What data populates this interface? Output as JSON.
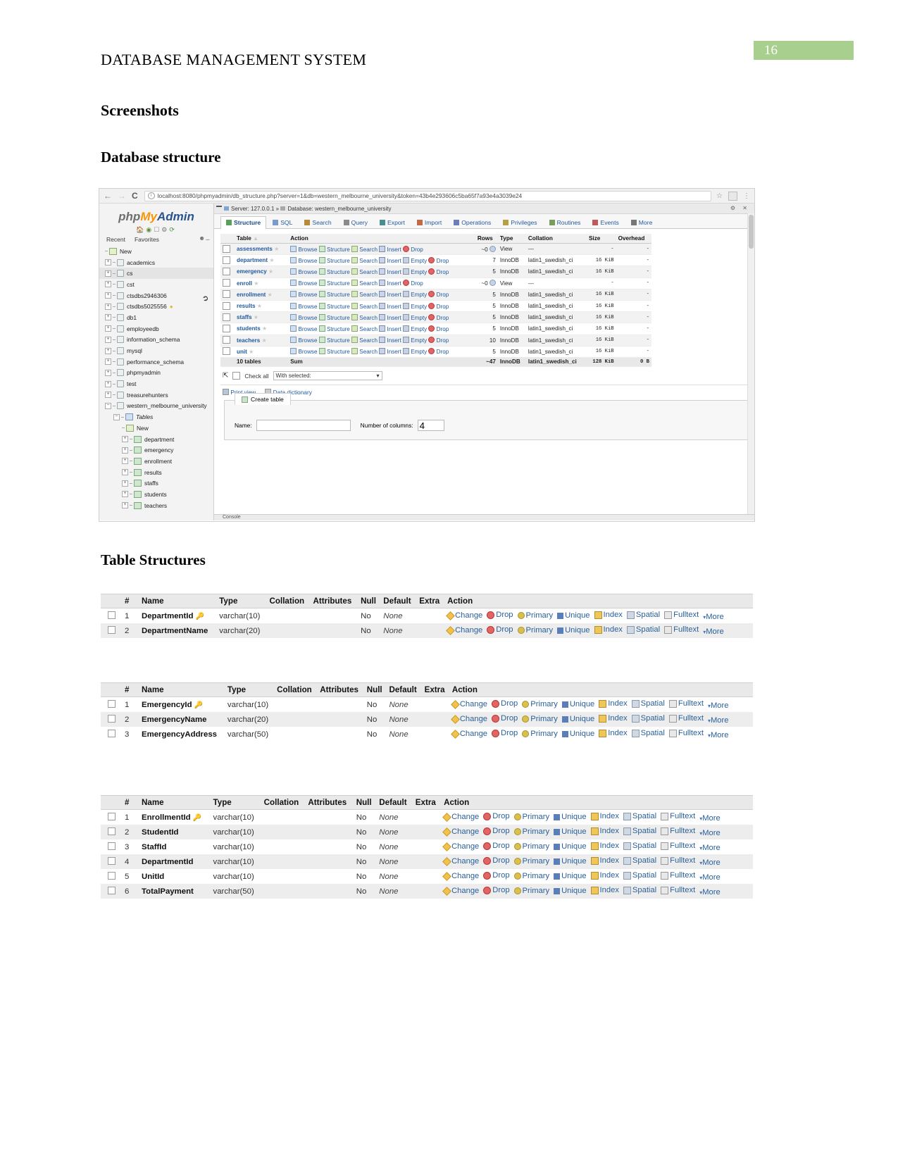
{
  "document": {
    "running_header": "DATABASE MANAGEMENT SYSTEM",
    "page_number": "16",
    "heading_screenshots": "Screenshots",
    "heading_db_structure": "Database structure",
    "heading_table_structures": "Table Structures"
  },
  "browser": {
    "back_icon": "←",
    "forward_icon": "→",
    "reload_icon": "C",
    "info_icon": "i",
    "url": "localhost:8080/phpmyadmin/db_structure.php?server=1&db=western_melbourne_university&token=43b4e293606c5ba65f7a93e4a3039e24",
    "star_icon": "☆",
    "menu_icon": "⋮"
  },
  "phpmyadmin": {
    "logo_php": "php",
    "logo_my": "My",
    "logo_admin": "Admin",
    "recent": "Recent",
    "favorites": "Favorites",
    "breadcrumb_server_label": "Server:",
    "breadcrumb_server_value": "127.0.0.1",
    "breadcrumb_sep": "»",
    "breadcrumb_db_label": "Database:",
    "breadcrumb_db_value": "western_melbourne_university",
    "tabs": [
      {
        "label": "Structure",
        "active": true
      },
      {
        "label": "SQL",
        "active": false
      },
      {
        "label": "Search",
        "active": false
      },
      {
        "label": "Query",
        "active": false
      },
      {
        "label": "Export",
        "active": false
      },
      {
        "label": "Import",
        "active": false
      },
      {
        "label": "Operations",
        "active": false
      },
      {
        "label": "Privileges",
        "active": false
      },
      {
        "label": "Routines",
        "active": false
      },
      {
        "label": "Events",
        "active": false
      },
      {
        "label": "More",
        "active": false
      }
    ],
    "tree": [
      {
        "label": "New",
        "level": 1,
        "type": "new"
      },
      {
        "label": "academics",
        "level": 1,
        "type": "db"
      },
      {
        "label": "cs",
        "level": 1,
        "type": "db",
        "selected": true
      },
      {
        "label": "cst",
        "level": 1,
        "type": "db"
      },
      {
        "label": "ctsdbs2946306",
        "level": 1,
        "type": "db"
      },
      {
        "label": "ctsdbs5025556",
        "level": 1,
        "type": "db",
        "bulb": true
      },
      {
        "label": "db1",
        "level": 1,
        "type": "db"
      },
      {
        "label": "employeedb",
        "level": 1,
        "type": "db"
      },
      {
        "label": "information_schema",
        "level": 1,
        "type": "db"
      },
      {
        "label": "mysql",
        "level": 1,
        "type": "db"
      },
      {
        "label": "performance_schema",
        "level": 1,
        "type": "db"
      },
      {
        "label": "phpmyadmin",
        "level": 1,
        "type": "db"
      },
      {
        "label": "test",
        "level": 1,
        "type": "db"
      },
      {
        "label": "treasurehunters",
        "level": 1,
        "type": "db"
      },
      {
        "label": "western_melbourne_university",
        "level": 1,
        "type": "db",
        "expanded": true
      },
      {
        "label": "Tables",
        "level": 2,
        "type": "folder"
      },
      {
        "label": "New",
        "level": 3,
        "type": "new"
      },
      {
        "label": "department",
        "level": 3,
        "type": "table"
      },
      {
        "label": "emergency",
        "level": 3,
        "type": "table"
      },
      {
        "label": "enrollment",
        "level": 3,
        "type": "table"
      },
      {
        "label": "results",
        "level": 3,
        "type": "table"
      },
      {
        "label": "staffs",
        "level": 3,
        "type": "table"
      },
      {
        "label": "students",
        "level": 3,
        "type": "table"
      },
      {
        "label": "teachers",
        "level": 3,
        "type": "table"
      }
    ],
    "grid_headers": [
      "Table",
      "Action",
      "Rows",
      "Type",
      "Collation",
      "Size",
      "Overhead"
    ],
    "grid_sort_arrow": "▲",
    "action_labels": {
      "browse": "Browse",
      "structure": "Structure",
      "search": "Search",
      "insert": "Insert",
      "empty": "Empty",
      "drop": "Drop"
    },
    "tables": [
      {
        "name": "assessments",
        "empty": false,
        "rows": "~0",
        "type": "View",
        "collation": "---",
        "size": "-",
        "overhead": "-"
      },
      {
        "name": "department",
        "empty": true,
        "rows": "7",
        "type": "InnoDB",
        "collation": "latin1_swedish_ci",
        "size": "16 KiB",
        "overhead": "-"
      },
      {
        "name": "emergency",
        "empty": true,
        "rows": "5",
        "type": "InnoDB",
        "collation": "latin1_swedish_ci",
        "size": "16 KiB",
        "overhead": "-"
      },
      {
        "name": "enroll",
        "empty": false,
        "rows": "~0",
        "type": "View",
        "collation": "---",
        "size": "-",
        "overhead": "-"
      },
      {
        "name": "enrollment",
        "empty": true,
        "rows": "5",
        "type": "InnoDB",
        "collation": "latin1_swedish_ci",
        "size": "16 KiB",
        "overhead": "-"
      },
      {
        "name": "results",
        "empty": true,
        "rows": "5",
        "type": "InnoDB",
        "collation": "latin1_swedish_ci",
        "size": "16 KiB",
        "overhead": "-"
      },
      {
        "name": "staffs",
        "empty": true,
        "rows": "5",
        "type": "InnoDB",
        "collation": "latin1_swedish_ci",
        "size": "16 KiB",
        "overhead": "-"
      },
      {
        "name": "students",
        "empty": true,
        "rows": "5",
        "type": "InnoDB",
        "collation": "latin1_swedish_ci",
        "size": "16 KiB",
        "overhead": "-"
      },
      {
        "name": "teachers",
        "empty": true,
        "rows": "10",
        "type": "InnoDB",
        "collation": "latin1_swedish_ci",
        "size": "16 KiB",
        "overhead": "-"
      },
      {
        "name": "unit",
        "empty": true,
        "rows": "5",
        "type": "InnoDB",
        "collation": "latin1_swedish_ci",
        "size": "16 KiB",
        "overhead": "-"
      }
    ],
    "summary": {
      "count": "10 tables",
      "label": "Sum",
      "rows": "~47",
      "type": "InnoDB",
      "collation": "latin1_swedish_ci",
      "size": "128 KiB",
      "overhead": "0 B"
    },
    "check_all": "Check all",
    "with_selected": "With selected:",
    "print_view": "Print view",
    "data_dictionary": "Data dictionary",
    "create_table": "Create table",
    "name_label": "Name:",
    "name_value": "",
    "columns_label": "Number of columns:",
    "columns_value": "4",
    "console": "Console"
  },
  "structure_headers": [
    "#",
    "Name",
    "Type",
    "Collation",
    "Attributes",
    "Null",
    "Default",
    "Extra",
    "Action"
  ],
  "structure_actions": [
    "Change",
    "Drop",
    "Primary",
    "Unique",
    "Index",
    "Spatial",
    "Fulltext",
    "More"
  ],
  "structures": [
    {
      "table": "department",
      "rows": [
        {
          "idx": "1",
          "name": "DepartmentId",
          "key": true,
          "type": "varchar(10)",
          "collation": "",
          "attributes": "",
          "null": "No",
          "default": "None",
          "extra": ""
        },
        {
          "idx": "2",
          "name": "DepartmentName",
          "key": false,
          "type": "varchar(20)",
          "collation": "",
          "attributes": "",
          "null": "No",
          "default": "None",
          "extra": ""
        }
      ]
    },
    {
      "table": "emergency",
      "rows": [
        {
          "idx": "1",
          "name": "EmergencyId",
          "key": true,
          "type": "varchar(10)",
          "collation": "",
          "attributes": "",
          "null": "No",
          "default": "None",
          "extra": ""
        },
        {
          "idx": "2",
          "name": "EmergencyName",
          "key": false,
          "type": "varchar(20)",
          "collation": "",
          "attributes": "",
          "null": "No",
          "default": "None",
          "extra": ""
        },
        {
          "idx": "3",
          "name": "EmergencyAddress",
          "key": false,
          "type": "varchar(50)",
          "collation": "",
          "attributes": "",
          "null": "No",
          "default": "None",
          "extra": ""
        }
      ]
    },
    {
      "table": "enrollment",
      "rows": [
        {
          "idx": "1",
          "name": "EnrollmentId",
          "key": true,
          "type": "varchar(10)",
          "collation": "",
          "attributes": "",
          "null": "No",
          "default": "None",
          "extra": ""
        },
        {
          "idx": "2",
          "name": "StudentId",
          "key": false,
          "type": "varchar(10)",
          "collation": "",
          "attributes": "",
          "null": "No",
          "default": "None",
          "extra": ""
        },
        {
          "idx": "3",
          "name": "StaffId",
          "key": false,
          "type": "varchar(10)",
          "collation": "",
          "attributes": "",
          "null": "No",
          "default": "None",
          "extra": ""
        },
        {
          "idx": "4",
          "name": "DepartmentId",
          "key": false,
          "type": "varchar(10)",
          "collation": "",
          "attributes": "",
          "null": "No",
          "default": "None",
          "extra": ""
        },
        {
          "idx": "5",
          "name": "UnitId",
          "key": false,
          "type": "varchar(10)",
          "collation": "",
          "attributes": "",
          "null": "No",
          "default": "None",
          "extra": ""
        },
        {
          "idx": "6",
          "name": "TotalPayment",
          "key": false,
          "type": "varchar(50)",
          "collation": "",
          "attributes": "",
          "null": "No",
          "default": "None",
          "extra": ""
        }
      ]
    }
  ],
  "colors": {
    "page_badge_bg": "#a9cf8f",
    "link": "#235a9e",
    "header_bg": "#e9e9e9"
  }
}
